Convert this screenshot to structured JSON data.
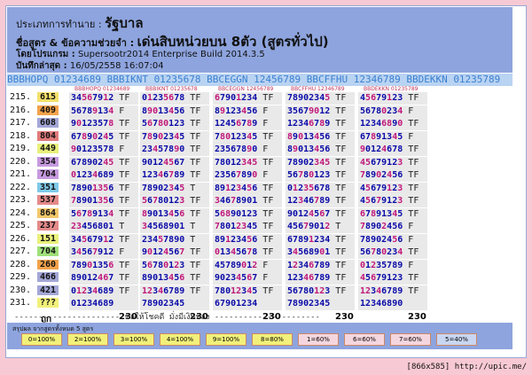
{
  "header": {
    "type_label": "ประเภทการทำนาย :",
    "type_value": "รัฐบาล",
    "formula_label": "ชื่อสูตร & ข้อความช่วยจำ :",
    "formula_value": "เด่นสิบหน่วยบน 8ตัว (สูตรทั่วไป)",
    "program_label": "โดยโปรแกรม :",
    "program_value": "Supersootr2014 Enterprise Build 2014.3.5",
    "saved_label": "บันทึกล่าสุด :",
    "saved_value": "16/05/2558 16:07:04"
  },
  "formula_bar": "BBBHOPQ 01234689 BBBIKNT 01235678 BBCEGGN 12456789 BBCFFHU 12346789 BBDEKKN 01235789",
  "column_heads": [
    "BBBHOPQ 01234689",
    "BBBIKNT 01235678",
    "BBCEGGN 12456789",
    "BBCFFHU 12346789",
    "BBDEKKN 01235789"
  ],
  "rows": [
    {
      "idx": "215.",
      "num": "615",
      "color": "#f2e06a",
      "cells": [
        "34567912 TF",
        "01235678 TF",
        "67901234 TF",
        "78902345 TF",
        "45679123 TF"
      ]
    },
    {
      "idx": "216.",
      "num": "409",
      "color": "#f2a24a",
      "cells": [
        "56789134 F",
        "89013456 TF",
        "89123456 F",
        "35679012 TF",
        "56780234 F"
      ]
    },
    {
      "idx": "217.",
      "num": "608",
      "color": "#a3a6d6",
      "cells": [
        "90123578 TF",
        "56780123 TF",
        "12456789 F",
        "12346789 TF",
        "12346890 TF"
      ]
    },
    {
      "idx": "218.",
      "num": "804",
      "color": "#e07b7b",
      "cells": [
        "67890245 TF",
        "78902345 TF",
        "78012345 TF",
        "89013456 TF",
        "67891345 F"
      ]
    },
    {
      "idx": "219.",
      "num": "449",
      "color": "#e9f07a",
      "cells": [
        "90123578 F",
        "23457890 TF",
        "23567890 F",
        "89013456 TF",
        "90124678 TF"
      ]
    },
    {
      "idx": "220.",
      "num": "354",
      "color": "#c79ae0",
      "cells": [
        "67890245 TF",
        "90124567 TF",
        "78012345 TF",
        "78902345 TF",
        "45679123 TF"
      ]
    },
    {
      "idx": "221.",
      "num": "704",
      "color": "#c79ae0",
      "cells": [
        "01234689 TF",
        "12346789 TF",
        "23567890 F",
        "56780123 TF",
        "78902456 TF"
      ]
    },
    {
      "idx": "222.",
      "num": "351",
      "color": "#7fc9e8",
      "cells": [
        "78901356 TF",
        "78902345 T",
        "89123456 TF",
        "01235678 TF",
        "45679123 TF"
      ]
    },
    {
      "idx": "223.",
      "num": "537",
      "color": "#e48a8a",
      "cells": [
        "78901356 TF",
        "56780123 TF",
        "34678901 TF",
        "12346789 TF",
        "45679123 TF"
      ]
    },
    {
      "idx": "224.",
      "num": "864",
      "color": "#f2c76a",
      "cells": [
        "56789134 TF",
        "89013456 TF",
        "56890123 TF",
        "90124567 TF",
        "67891345 TF"
      ]
    },
    {
      "idx": "225.",
      "num": "237",
      "color": "#e48a8a",
      "cells": [
        "23456801 T",
        "34568901 T",
        "78012345 TF",
        "45679012 T",
        "78902456 F"
      ]
    },
    {
      "idx": "226.",
      "num": "151",
      "color": "#e9f07a",
      "cells": [
        "34567912 TF",
        "23457890 T",
        "89123456 TF",
        "67891234 TF",
        "78902456 F"
      ]
    },
    {
      "idx": "227.",
      "num": "704",
      "color": "#9fe07a",
      "cells": [
        "34567912 F",
        "90124567 TF",
        "01345678 TF",
        "34568901 TF",
        "56780234 TF"
      ]
    },
    {
      "idx": "228.",
      "num": "260",
      "color": "#f2a24a",
      "cells": [
        "78901356 TF",
        "56780123 TF",
        "45789012 F",
        "12346789 TF",
        "01235789 F"
      ]
    },
    {
      "idx": "229.",
      "num": "466",
      "color": "#a3a6d6",
      "cells": [
        "89012467 TF",
        "89013456 TF",
        "90234567 F",
        "12346789 TF",
        "45679123 TF"
      ]
    },
    {
      "idx": "230.",
      "num": "421",
      "color": "#a3a6d6",
      "cells": [
        "01234689 TF",
        "12346789 TF",
        "78012345 TF",
        "56780123 TF",
        "12346789 TF"
      ]
    },
    {
      "idx": "231.",
      "num": "???",
      "color": "#f2f07a",
      "cells": [
        "01234689",
        "78902345",
        "67901234",
        "78902345",
        "12346890"
      ]
    }
  ],
  "hit_label": "ถูก",
  "miss_label": "ผิด",
  "hit_counts": [
    "230",
    "230",
    "230",
    "230",
    "230"
  ],
  "miss_counts": [
    "0",
    "0",
    "0",
    "0",
    "0"
  ],
  "separator_text": "---------------------- ขอให้โชคดี มั่งมีเงินทอง ----------------------",
  "summary": {
    "label": "สรุปผล จากสูตรทั้งหมด 5 สูตร",
    "chips": [
      {
        "text": "0=100%",
        "bg": "#f2f07a"
      },
      {
        "text": "2=100%",
        "bg": "#f2f07a"
      },
      {
        "text": "3=100%",
        "bg": "#f2f07a"
      },
      {
        "text": "4=100%",
        "bg": "#f2f07a"
      },
      {
        "text": "9=100%",
        "bg": "#f2f07a"
      },
      {
        "text": "8=80%",
        "bg": "#f2f07a"
      },
      {
        "text": "1=60%",
        "bg": "#f5d6df"
      },
      {
        "text": "6=60%",
        "bg": "#f5d6df"
      },
      {
        "text": "7=60%",
        "bg": "#f5d6df"
      },
      {
        "text": "5=40%",
        "bg": "#c9d6f2"
      }
    ]
  },
  "watermark": "[866x585] http://upic.me/"
}
